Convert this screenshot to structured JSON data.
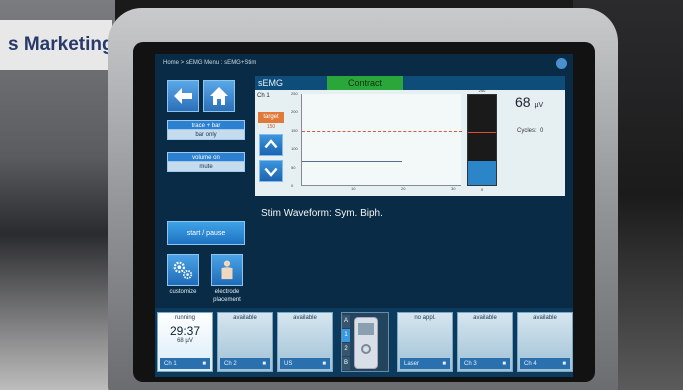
{
  "backdrop": {
    "sign_text": "s Marketing"
  },
  "breadcrumb": "Home > sEMG Menu : sEMG+Stim",
  "nav": {
    "back_icon": "back-arrow-icon",
    "home_icon": "home-icon"
  },
  "options": [
    {
      "title": "trace + bar",
      "value": "bar only"
    },
    {
      "title": "volume on",
      "value": "mute"
    }
  ],
  "start_label": "start / pause",
  "tools": [
    {
      "icon": "gears-icon",
      "label": "customize"
    },
    {
      "icon": "body-icon",
      "label": "electrode placement"
    }
  ],
  "chart": {
    "mode": "sEMG",
    "state": "Contract",
    "channel": "Ch 1",
    "target_label": "target",
    "target_value": "150",
    "y_ticks": [
      "250",
      "200",
      "150",
      "100",
      "50",
      "0"
    ],
    "x_ticks": [
      "10",
      "20",
      "30"
    ],
    "meter_top": "250",
    "meter_bottom": "0",
    "reading_value": "68",
    "reading_unit": "µV",
    "cycles_label": "Cycles:",
    "cycles_value": "0"
  },
  "chart_data": {
    "type": "line",
    "ylim": [
      0,
      250
    ],
    "target": 150,
    "signal_level": 68,
    "meter_value": 68
  },
  "stim_waveform": "Stim Waveform: Sym. Biph.",
  "channels": [
    {
      "status": "running",
      "time": "29:37",
      "reading": "68 µV",
      "name": "Ch 1",
      "active": true
    },
    {
      "status": "available",
      "time": "",
      "reading": "",
      "name": "Ch 2",
      "active": false
    },
    {
      "status": "available",
      "time": "",
      "reading": "",
      "name": "US",
      "active": false
    },
    {
      "status": "no appl.",
      "time": "",
      "reading": "",
      "name": "Laser",
      "active": false
    },
    {
      "status": "available",
      "time": "",
      "reading": "",
      "name": "Ch 3",
      "active": false
    },
    {
      "status": "available",
      "time": "",
      "reading": "",
      "name": "Ch 4",
      "active": false
    }
  ],
  "center_tabs": [
    "A",
    "1",
    "2",
    "B"
  ],
  "colors": {
    "accent": "#2d7fcf",
    "contract": "#2aa63a",
    "target": "#e07a3a",
    "screen": "#0a2b45"
  }
}
